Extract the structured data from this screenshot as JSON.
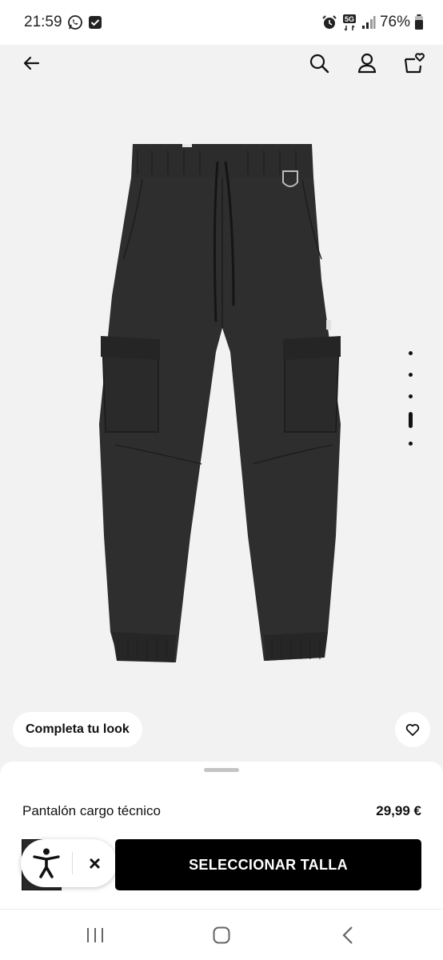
{
  "status_bar": {
    "time": "21:59",
    "battery": "76%",
    "network": "5G"
  },
  "header": {
    "back_icon": "arrow-left-icon",
    "search_icon": "search-icon",
    "account_icon": "user-icon",
    "wishlist_bag_icon": "bag-heart-icon"
  },
  "product": {
    "image_alt_description_icon": "cargo-pants-image",
    "carousel": {
      "total": 5,
      "active_index": 4
    },
    "name": "Pantalón cargo técnico",
    "price": "29,99 €"
  },
  "actions": {
    "complete_look": "Completa tu look",
    "select_size": "SELECCIONAR TALLA"
  },
  "accessibility": {
    "icon": "accessibility-icon",
    "close": "×"
  },
  "colors": {
    "button_bg": "#000000",
    "page_bg": "#f2f2f2",
    "product": "#2a2a2a"
  }
}
